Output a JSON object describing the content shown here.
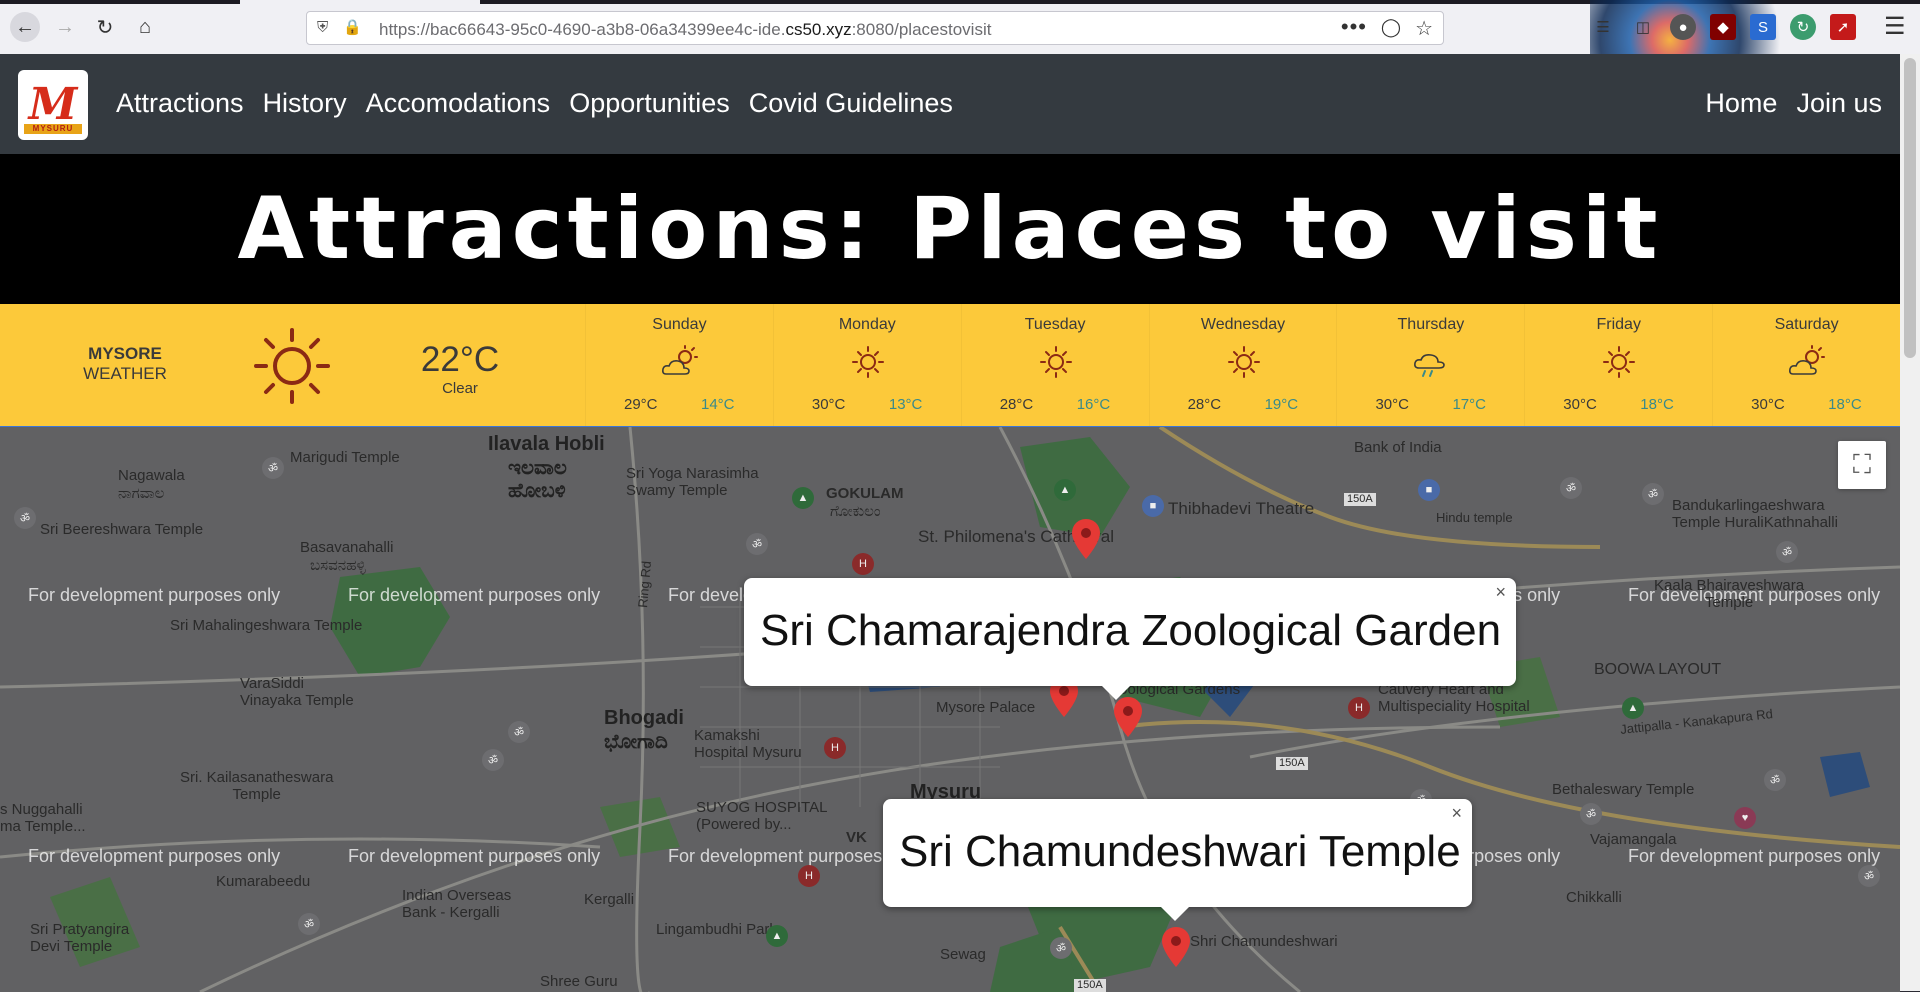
{
  "browser": {
    "url_prefix": "https://bac66643-95c0-4690-a3b8-06a34399ee4c-ide.",
    "url_domain": "cs50.xyz",
    "url_suffix": ":8080/placestovisit",
    "dots": "•••"
  },
  "nav": {
    "links": [
      "Attractions",
      "History",
      "Accomodations",
      "Opportunities",
      "Covid Guidelines"
    ],
    "right_links": [
      "Home",
      "Join us"
    ],
    "logo_sub": "MYSURU"
  },
  "banner": {
    "title": "Attractions: Places to visit"
  },
  "weather": {
    "city": "MYSORE",
    "label": "WEATHER",
    "current_temp": "22°C",
    "current_desc": "Clear",
    "days": [
      {
        "name": "Sunday",
        "icon": "partly-cloudy-icon",
        "hi": "29°C",
        "lo": "14°C"
      },
      {
        "name": "Monday",
        "icon": "sun-icon",
        "hi": "30°C",
        "lo": "13°C"
      },
      {
        "name": "Tuesday",
        "icon": "sun-icon",
        "hi": "28°C",
        "lo": "16°C"
      },
      {
        "name": "Wednesday",
        "icon": "sun-icon",
        "hi": "28°C",
        "lo": "19°C"
      },
      {
        "name": "Thursday",
        "icon": "rain-icon",
        "hi": "30°C",
        "lo": "17°C"
      },
      {
        "name": "Friday",
        "icon": "sun-icon",
        "hi": "30°C",
        "lo": "18°C"
      },
      {
        "name": "Saturday",
        "icon": "partly-cloudy-icon",
        "hi": "30°C",
        "lo": "18°C"
      }
    ]
  },
  "map": {
    "dev_notice": "For development purposes only",
    "infowindows": [
      "Sri Chamarajendra Zoological Garden",
      "Sri Chamundeshwari Temple"
    ],
    "close": "×",
    "labels": {
      "ilavala": "Ilavala Hobli",
      "ilavala_kn": "ಇಲವಾಲ\nಹೋಬಳಿ",
      "marigudi": "Marigudi Temple",
      "nagawala": "Nagawala",
      "nagawala_kn": "ನಾಗವಾಲ",
      "beereshwara": "Sri Beereshwara Temple",
      "yoga": "Sri Yoga Narasimha\nSwamy Temple",
      "gokulam": "GOKULAM",
      "gokulam_kn": "ಗೋಕುಲಂ",
      "philomena": "St. Philomena's Cathedral",
      "thibhadevi": "Thibhadevi Theatre",
      "bank_india": "Bank of India",
      "bandukar": "Bandukarlingaeshwara\nTemple HuraliKathnahalli",
      "hindu_temple": "Hindu temple",
      "kaala": "Kaala Bhairaveshwara\nTemple",
      "basavana": "Basavanahalli",
      "basavana_kn": "ಬಸವನಹಳ್ಳಿ",
      "mahalinge": "Sri Mahalingeshwara Temple",
      "ring_rd": "Ring Rd",
      "mysore_palace": "Mysore Palace",
      "zoo_gardens": "Zoological Gardens",
      "cauvery": "Cauvery Heart and\nMultispeciality Hospital",
      "boowa": "BOOWA LAYOUT",
      "jattipalla": "Jattipalla - Kanakapura Rd",
      "varasiddi": "VaraSiddi\nVinayaka Temple",
      "bhogadi": "Bhogadi",
      "bhogadi_kn": "ಭೋಗಾದಿ",
      "kamakshi": "Kamakshi\nHospital Mysuru",
      "kailasa": "Sri. Kailasanatheswara\nTemple",
      "mysuru": "Mysuru",
      "bethaleswary": "Bethaleswary Temple",
      "nuggahalli": "s Nuggahalli\nma Temple...",
      "suyog": "SUYOG HOSPITAL\n(Powered by...",
      "vajamangala": "Vajamangala",
      "kumarabeedu": "Kumarabeedu",
      "indian_overseas": "Indian Overseas\nBank - Kergalli",
      "kergalli": "Kergalli",
      "chikkalli": "Chikkalli",
      "pratyangira": "Sri Pratyangira\nDevi Temple",
      "lingambudhi": "Lingambudhi Park",
      "shree_guru": "Shree Guru",
      "chamundeshwari_lbl": "Shri Chamundeshwari",
      "sewage": "Sewag",
      "vk": "VK",
      "road_150a": "150A"
    }
  }
}
